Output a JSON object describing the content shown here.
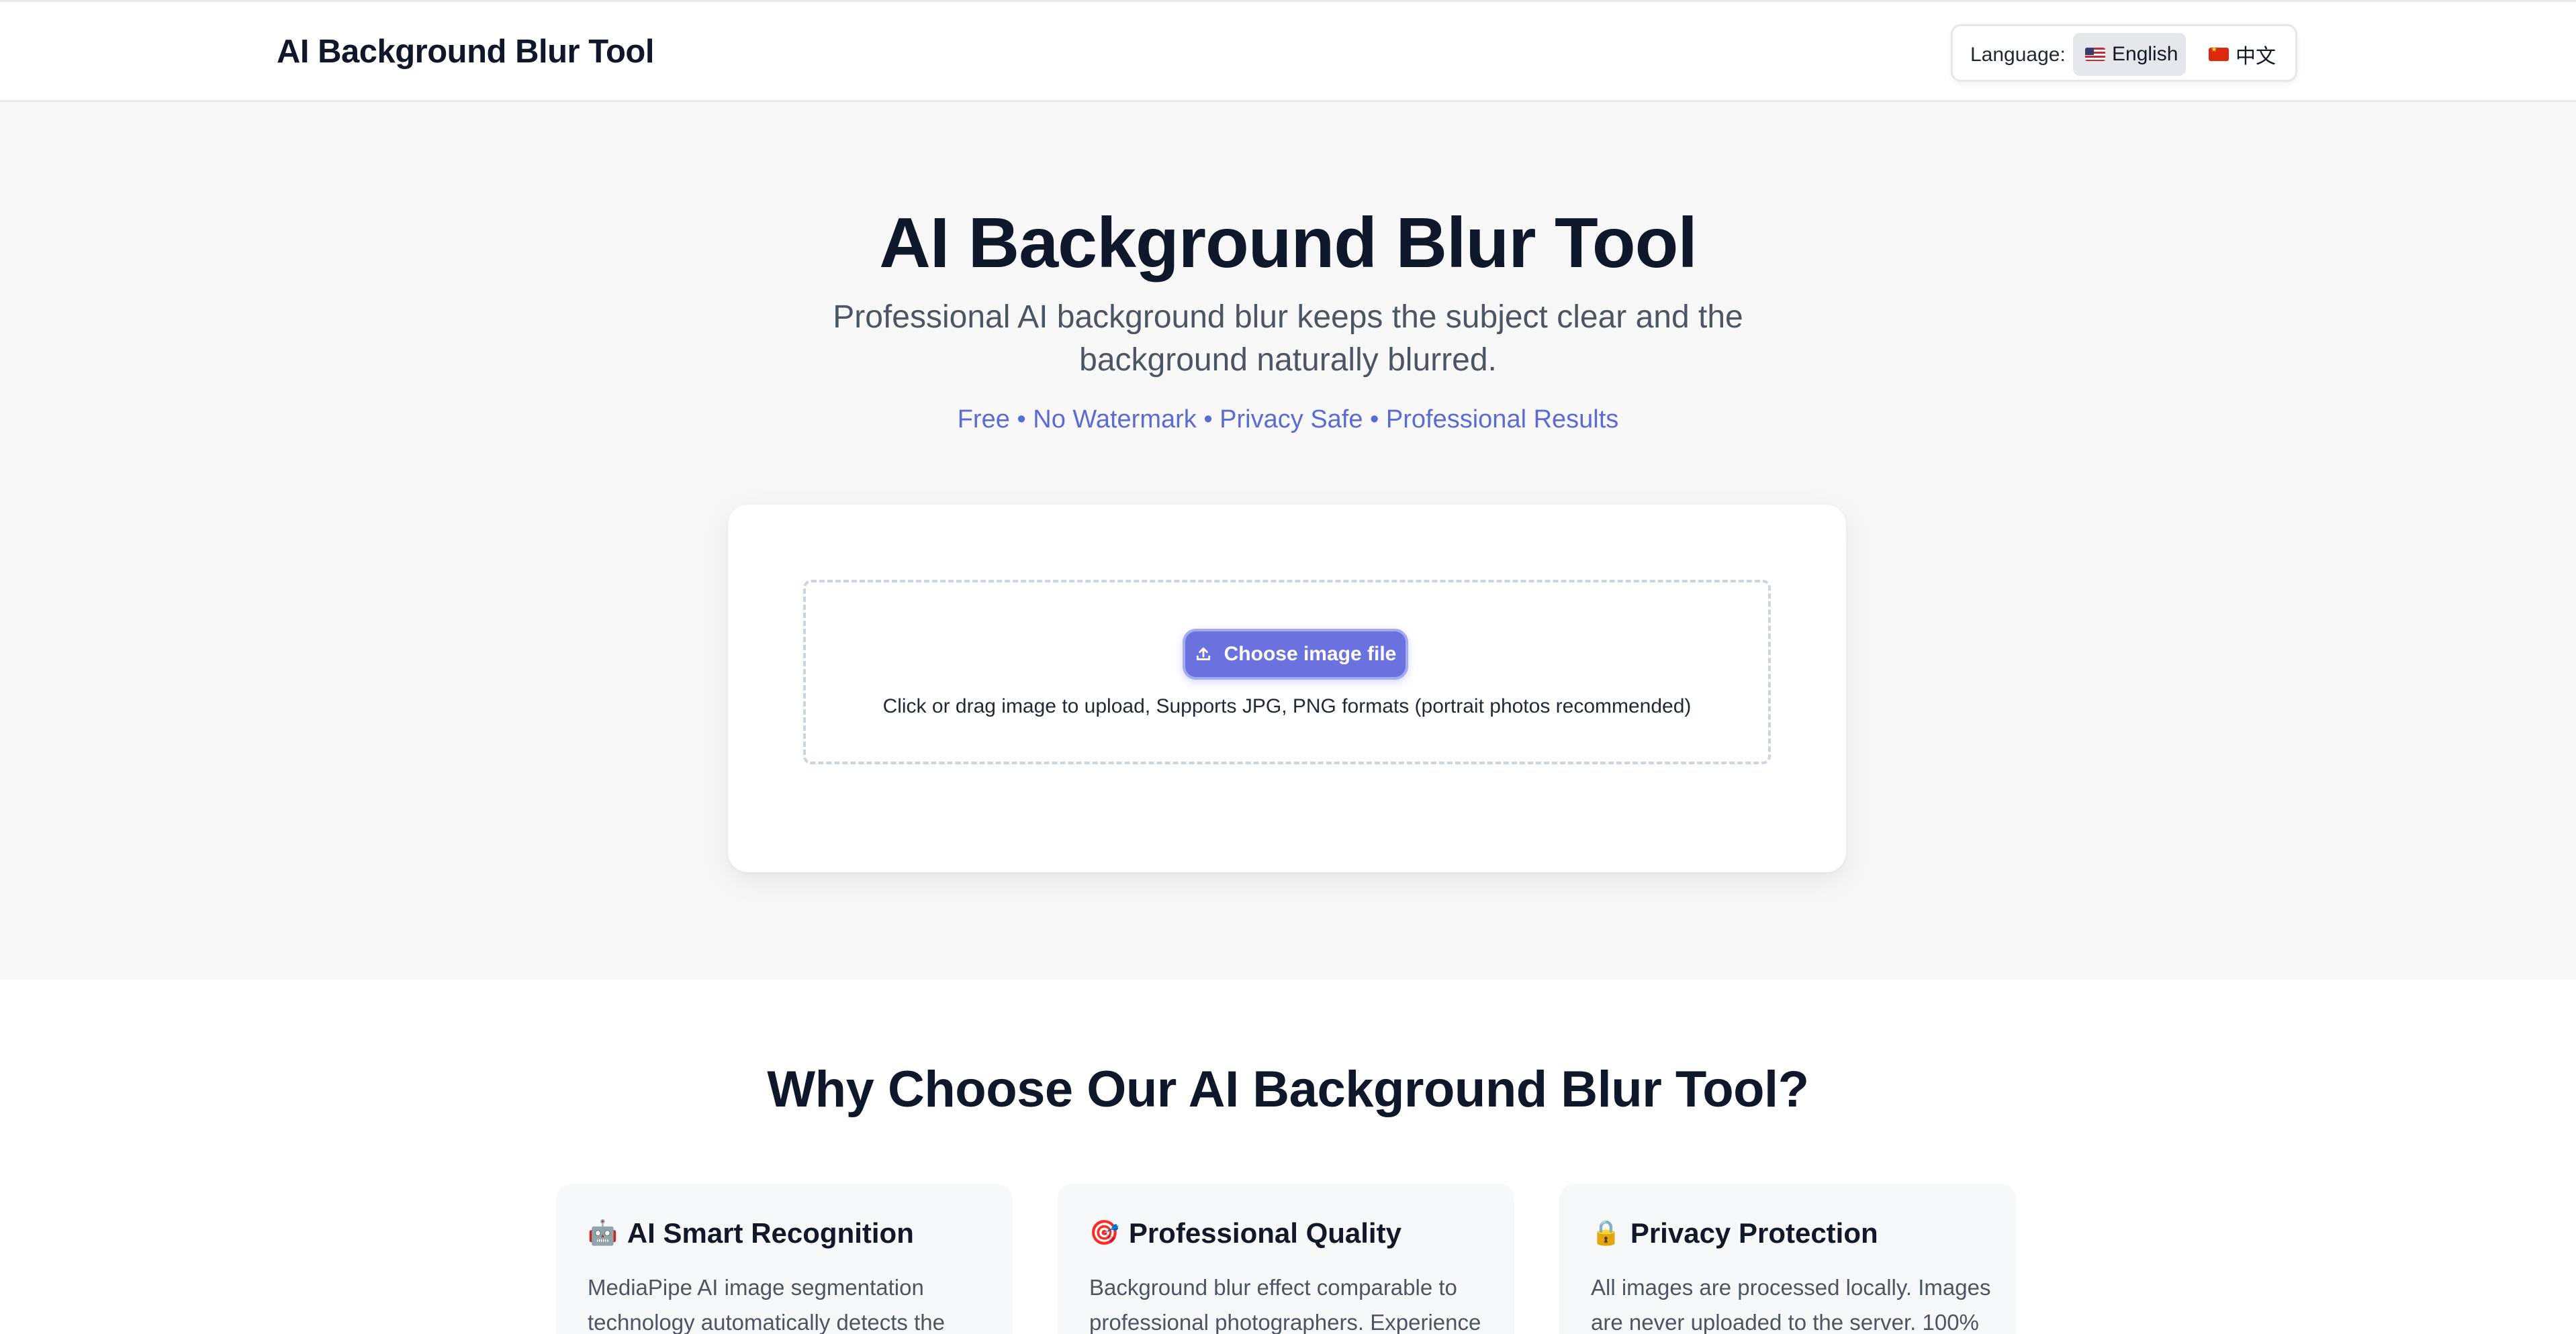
{
  "header": {
    "brand": "AI Background Blur Tool",
    "language_label": "Language:",
    "languages": [
      {
        "label": "English",
        "flag": "us-flag",
        "selected": true
      },
      {
        "label": "中文",
        "flag": "cn-flag",
        "selected": false
      }
    ]
  },
  "hero": {
    "title": "AI Background Blur Tool",
    "subtitle": "Professional AI background blur keeps the subject clear and the background naturally blurred.",
    "tags": "Free • No Watermark • Privacy Safe • Professional Results"
  },
  "upload": {
    "button_label": "Choose image file",
    "button_icon": "upload-icon",
    "hint": "Click or drag image to upload, Supports JPG, PNG formats (portrait photos recommended)"
  },
  "why": {
    "title": "Why Choose Our AI Background Blur Tool?",
    "features": [
      {
        "icon": "🤖",
        "title": "AI Smart Recognition",
        "desc": "MediaPipe AI image segmentation technology automatically detects the"
      },
      {
        "icon": "🎯",
        "title": "Professional Quality",
        "desc": "Background blur effect comparable to professional photographers. Experience"
      },
      {
        "icon": "🔒",
        "title": "Privacy Protection",
        "desc": "All images are processed locally. Images are never uploaded to the server. 100%"
      }
    ]
  },
  "colors": {
    "accent": "#6b72e0",
    "tag_text": "#5b6bd5",
    "hero_bg": "#f8f8f8"
  }
}
